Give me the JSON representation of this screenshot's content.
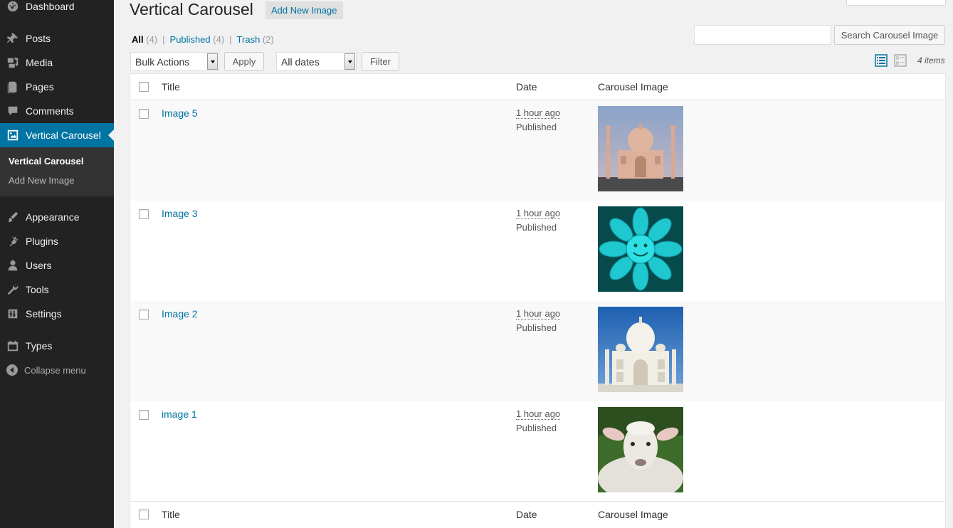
{
  "sidebar": {
    "items": [
      {
        "label": "Dashboard",
        "icon": "dashboard-icon"
      },
      {
        "label": "Posts",
        "icon": "pin-icon"
      },
      {
        "label": "Media",
        "icon": "media-icon"
      },
      {
        "label": "Pages",
        "icon": "pages-icon"
      },
      {
        "label": "Comments",
        "icon": "comment-icon"
      },
      {
        "label": "Vertical Carousel",
        "icon": "image-icon",
        "active": true
      },
      {
        "label": "Appearance",
        "icon": "brush-icon"
      },
      {
        "label": "Plugins",
        "icon": "plug-icon"
      },
      {
        "label": "Users",
        "icon": "user-icon"
      },
      {
        "label": "Tools",
        "icon": "wrench-icon"
      },
      {
        "label": "Settings",
        "icon": "sliders-icon"
      },
      {
        "label": "Types",
        "icon": "calendar-icon"
      }
    ],
    "submenu": [
      {
        "label": "Vertical Carousel",
        "current": true
      },
      {
        "label": "Add New Image",
        "current": false
      }
    ],
    "collapse_label": "Collapse menu"
  },
  "header": {
    "title": "Vertical Carousel",
    "add_new_label": "Add New Image"
  },
  "views": {
    "all_label": "All",
    "all_count": "(4)",
    "published_label": "Published",
    "published_count": "(4)",
    "trash_label": "Trash",
    "trash_count": "(2)",
    "separator": "|"
  },
  "search": {
    "value": "",
    "button_label": "Search Carousel Image"
  },
  "tablenav": {
    "bulk_actions": "Bulk Actions",
    "apply_label": "Apply",
    "dates": "All dates",
    "filter_label": "Filter",
    "items_count": "4 items"
  },
  "table": {
    "columns": [
      "Title",
      "Date",
      "Carousel Image"
    ],
    "rows": [
      {
        "title": "Image 5",
        "date": "1 hour ago",
        "status": "Published",
        "image": "taj-mahal-dusk"
      },
      {
        "title": "Image 3",
        "date": "1 hour ago",
        "status": "Published",
        "image": "smiley-flower"
      },
      {
        "title": "Image 2",
        "date": "1 hour ago",
        "status": "Published",
        "image": "taj-mahal-day"
      },
      {
        "title": "image 1",
        "date": "1 hour ago",
        "status": "Published",
        "image": "lamb"
      }
    ]
  },
  "colors": {
    "sidebar_bg": "#222222",
    "active_menu": "#0074a2",
    "link": "#0074a2",
    "page_bg": "#f1f1f1"
  }
}
